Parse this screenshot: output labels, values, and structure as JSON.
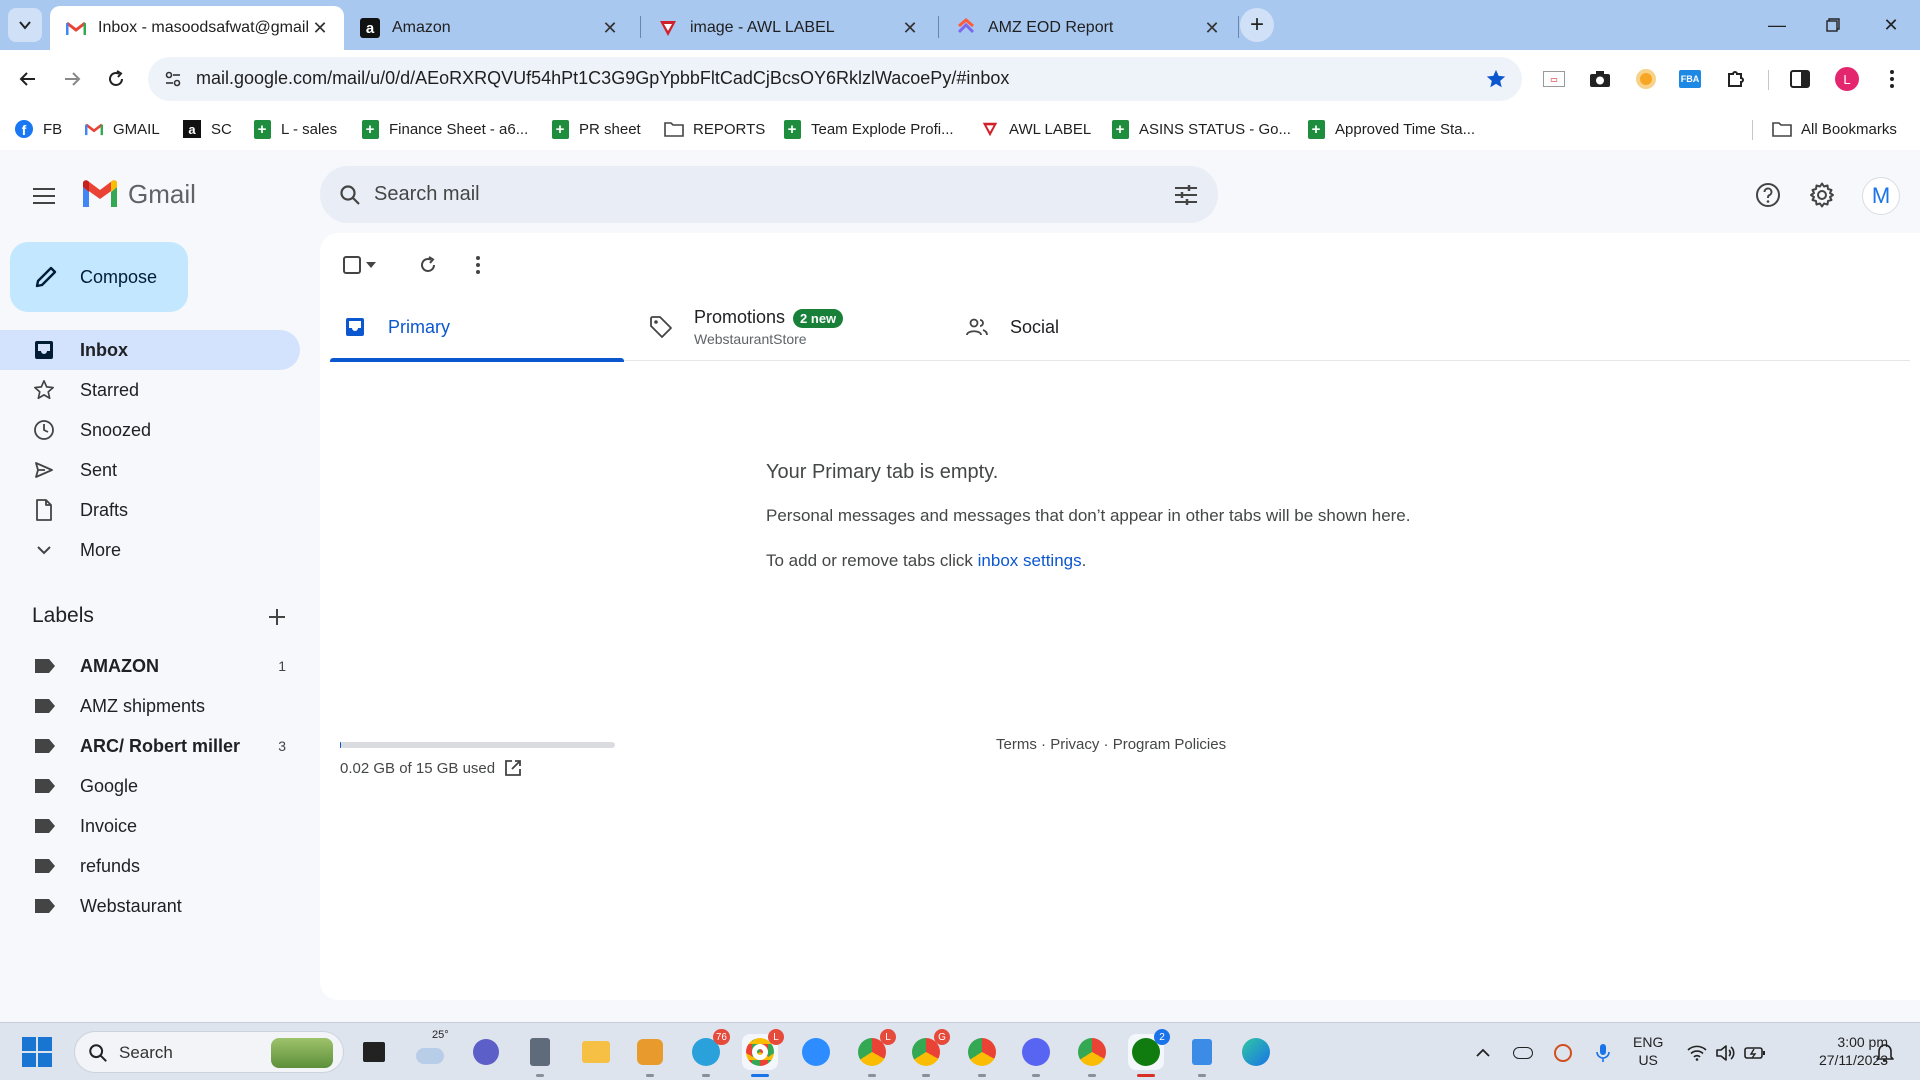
{
  "browser": {
    "tabs": [
      {
        "title": "Inbox - masoodsafwat@gmail.",
        "icon": "gmail-icon",
        "active": true
      },
      {
        "title": "Amazon",
        "icon": "amazon-icon",
        "active": false
      },
      {
        "title": "image - AWL LABEL",
        "icon": "awl-icon",
        "active": false
      },
      {
        "title": "AMZ EOD Report",
        "icon": "clickup-icon",
        "active": false
      }
    ],
    "url": "mail.google.com/mail/u/0/d/AEoRXRQVUf54hPt1C3G9GpYpbbFltCadCjBcsOY6RklzlWacoePy/#inbox",
    "profile_initial": "L",
    "bookmarks": [
      "FB",
      "GMAIL",
      "SC",
      "L - sales",
      "Finance Sheet - a6...",
      "PR sheet",
      "REPORTS",
      "Team Explode Profi...",
      "AWL LABEL",
      "ASINS STATUS - Go...",
      "Approved Time Sta..."
    ],
    "all_bookmarks": "All Bookmarks"
  },
  "gmail": {
    "logo_text": "Gmail",
    "search_placeholder": "Search mail",
    "avatar_initial": "M",
    "compose_label": "Compose",
    "nav": [
      "Inbox",
      "Starred",
      "Snoozed",
      "Sent",
      "Drafts",
      "More"
    ],
    "labels_title": "Labels",
    "labels": [
      {
        "name": "AMAZON",
        "count": "1",
        "bold": true
      },
      {
        "name": "AMZ shipments",
        "count": "",
        "bold": false
      },
      {
        "name": "ARC/ Robert miller",
        "count": "3",
        "bold": true
      },
      {
        "name": "Google",
        "count": "",
        "bold": false
      },
      {
        "name": "Invoice",
        "count": "",
        "bold": false
      },
      {
        "name": "refunds",
        "count": "",
        "bold": false
      },
      {
        "name": "Webstaurant",
        "count": "",
        "bold": false
      }
    ],
    "tabs": {
      "primary": "Primary",
      "promotions": "Promotions",
      "promotions_badge": "2 new",
      "promotions_sub": "WebstaurantStore",
      "social": "Social"
    },
    "empty": {
      "title": "Your Primary tab is empty.",
      "desc": "Personal messages and messages that don’t appear in other tabs will be shown here.",
      "hint_prefix": "To add or remove tabs click ",
      "hint_link": "inbox settings",
      "hint_suffix": "."
    },
    "storage": {
      "text": "0.02 GB of 15 GB used",
      "used_fraction": 0.0013
    },
    "footer": {
      "terms": "Terms",
      "privacy": "Privacy",
      "policies": "Program Policies",
      "sep": " · "
    }
  },
  "taskbar": {
    "search_label": "Search",
    "weather_temp": "25°",
    "badges": {
      "telegram": "76",
      "chrome_1": "L",
      "chrome_2": "L",
      "chrome_3": "G",
      "xbox": "2"
    },
    "lang_line1": "ENG",
    "lang_line2": "US",
    "time": "3:00 pm",
    "date": "27/11/2023"
  }
}
